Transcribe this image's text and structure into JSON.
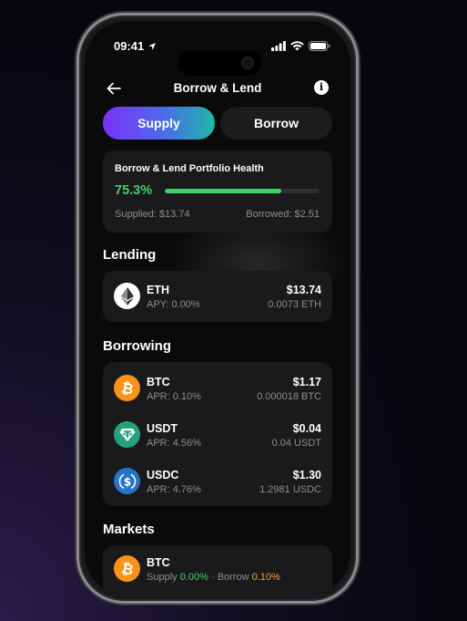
{
  "status": {
    "time": "09:41"
  },
  "nav": {
    "title": "Borrow & Lend",
    "info": "i"
  },
  "segments": {
    "supply": "Supply",
    "borrow": "Borrow",
    "active": "supply"
  },
  "health": {
    "title": "Borrow & Lend Portfolio Health",
    "percent_label": "75.3%",
    "percent": 75.3,
    "supplied": "Supplied: $13.74",
    "borrowed": "Borrowed: $2.51"
  },
  "lending": {
    "title": "Lending",
    "items": [
      {
        "name": "ETH",
        "rate": "APY: 0.00%",
        "usd": "$13.74",
        "amount": "0.0073 ETH",
        "icon": "eth-icon"
      }
    ]
  },
  "borrowing": {
    "title": "Borrowing",
    "items": [
      {
        "name": "BTC",
        "rate": "APR: 0.10%",
        "usd": "$1.17",
        "amount": "0.000018 BTC",
        "icon": "btc-icon"
      },
      {
        "name": "USDT",
        "rate": "APR: 4.56%",
        "usd": "$0.04",
        "amount": "0.04 USDT",
        "icon": "usdt-icon"
      },
      {
        "name": "USDC",
        "rate": "APR: 4.76%",
        "usd": "$1.30",
        "amount": "1.2981 USDC",
        "icon": "usdc-icon"
      }
    ]
  },
  "markets": {
    "title": "Markets",
    "items": [
      {
        "name": "BTC",
        "supply_label": "Supply ",
        "supply_rate": "0.00%",
        "sep": " · ",
        "borrow_label": "Borrow ",
        "borrow_rate": "0.10%",
        "icon": "btc-icon"
      }
    ]
  },
  "colors": {
    "green": "#3fd16b",
    "orange": "#f7a33a",
    "btc": "#f7931a",
    "usdt": "#26a17b",
    "usdc": "#2775ca"
  }
}
